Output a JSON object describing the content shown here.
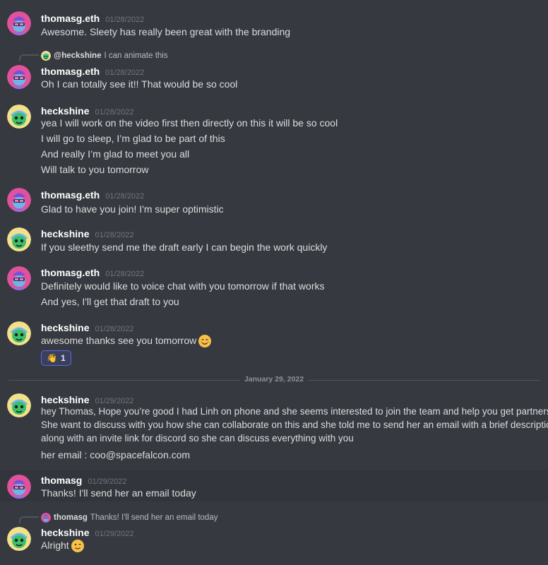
{
  "messages": [
    {
      "user": "thomasg.eth",
      "time": "01/28/2022",
      "lines": [
        "Awesome. Sleety has really been great with the branding"
      ]
    },
    {
      "user": "thomasg.eth",
      "time": "01/28/2022",
      "reply": {
        "name": "@heckshine",
        "text": "I can animate this"
      },
      "lines": [
        "Oh I can totally see it!! That would be so cool"
      ]
    },
    {
      "user": "heckshine",
      "time": "01/28/2022",
      "lines": [
        "yea I will work on the video first then directly on this it will be so cool",
        "I will go to sleep, I’m glad to be part of this",
        "And really I’m glad to meet you all",
        "Will talk to you tomorrow"
      ]
    },
    {
      "user": "thomasg.eth",
      "time": "01/28/2022",
      "lines": [
        "Glad to have you join! I'm super optimistic"
      ]
    },
    {
      "user": "heckshine",
      "time": "01/28/2022",
      "lines": [
        "If you sleethy send me the draft early I can begin the work quickly"
      ]
    },
    {
      "user": "thomasg.eth",
      "time": "01/28/2022",
      "lines": [
        "Definitely would like to voice chat with you tomorrow if that works",
        "And yes, I'll get that draft to you"
      ]
    },
    {
      "user": "heckshine",
      "time": "01/28/2022",
      "lines": [
        "awesome thanks see you tomorrow"
      ],
      "reaction": {
        "emoji": "👋",
        "count": "1"
      }
    },
    {
      "user": "heckshine",
      "time": "01/29/2022",
      "lines": [
        "hey Thomas, Hope you’re good I had Linh on phone and she seems interested to join the team and help you get partnerships.",
        "She want to discuss with you how she can collaborate on this and she told me to send her an email with a brief description",
        "along with an invite link for discord so she can discuss everything with you",
        "her email : coo@spacefalcon.com"
      ]
    },
    {
      "user": "thomasg",
      "time": "01/29/2022",
      "lines": [
        "Thanks! I'll send her an email today"
      ]
    },
    {
      "user": "heckshine",
      "time": "01/29/2022",
      "reply": {
        "name": "thomasg",
        "text": "Thanks! I'll send her an email today"
      },
      "lines": [
        "Alright"
      ]
    }
  ],
  "date_divider": "January 29, 2022",
  "icons": {
    "smile_emoji": "smiling-face-icon",
    "wink_emoji": "winking-face-icon",
    "wave_emoji": "waving-hand-icon"
  },
  "colors": {
    "background": "#36393f",
    "reaction_border": "#5865f2",
    "thomas_avatar": "#e0529c",
    "heck_avatar": "#f2e08a"
  }
}
